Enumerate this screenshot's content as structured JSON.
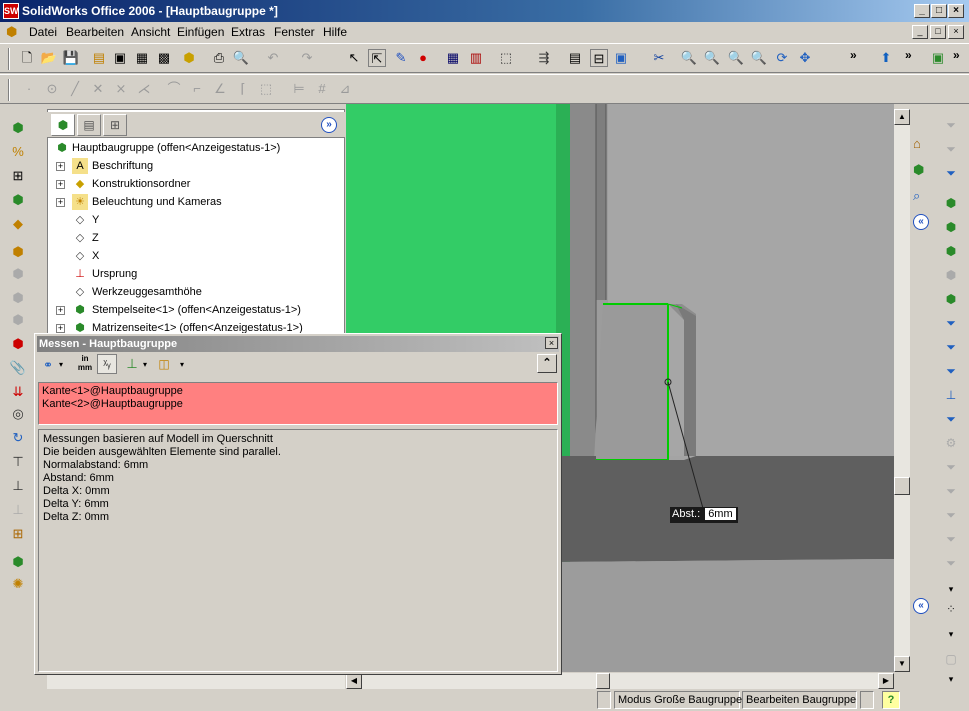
{
  "window": {
    "title": "SolidWorks Office 2006 - [Hauptbaugruppe *]",
    "app_icon": "SW",
    "caption_buttons": [
      "_",
      "□",
      "×"
    ],
    "mdi_buttons": [
      "_",
      "□",
      "×"
    ]
  },
  "menu": [
    "Datei",
    "Bearbeiten",
    "Ansicht",
    "Einfügen",
    "Extras",
    "Fenster",
    "Hilfe"
  ],
  "featuremanager": {
    "root": "Hauptbaugruppe  (offen<Anzeigestatus-1>)",
    "items": [
      {
        "label": "Beschriftung",
        "icon": "annotation-icon",
        "expandable": true
      },
      {
        "label": "Konstruktionsordner",
        "icon": "design-folder-icon",
        "expandable": true
      },
      {
        "label": "Beleuchtung und Kameras",
        "icon": "lights-cameras-icon",
        "expandable": true
      },
      {
        "label": "Y",
        "icon": "plane-icon",
        "expandable": false
      },
      {
        "label": "Z",
        "icon": "plane-icon",
        "expandable": false
      },
      {
        "label": "X",
        "icon": "plane-icon",
        "expandable": false
      },
      {
        "label": "Ursprung",
        "icon": "origin-icon",
        "expandable": false
      },
      {
        "label": "Werkzeuggesamthöhe",
        "icon": "plane-icon",
        "expandable": false
      },
      {
        "label": "Stempelseite<1> (offen<Anzeigestatus-1>)",
        "icon": "part-icon",
        "expandable": true
      },
      {
        "label": "Matrizenseite<1> (offen<Anzeigestatus-1>)",
        "icon": "part-icon",
        "expandable": true
      }
    ]
  },
  "measure": {
    "title": "Messen - Hauptbaugruppe",
    "unit_icon_top": "in",
    "unit_icon_bottom": "mm",
    "selections": [
      "Kante<1>@Hauptbaugruppe",
      "Kante<2>@Hauptbaugruppe"
    ],
    "results": [
      "Messungen basieren auf Modell im Querschnitt",
      "Die beiden ausgewählten Elemente sind parallel.",
      "Normalabstand: 6mm",
      "Abstand: 6mm",
      "Delta X: 0mm",
      "Delta Y: 6mm",
      "Delta Z: 0mm"
    ],
    "close": "×",
    "collapse": "⌃"
  },
  "viewport": {
    "callout_label": "Abst.:",
    "callout_value": "6mm",
    "colors": {
      "green_face": "#33cc66",
      "body_light": "#a8a8a8",
      "body_mid": "#8c8c8c",
      "body_dark": "#5e5e5e",
      "edge_highlight": "#00cc00"
    }
  },
  "statusbar": {
    "mode": "Modus Große Baugruppe",
    "editing": "Bearbeiten Baugruppe",
    "help": "?"
  }
}
